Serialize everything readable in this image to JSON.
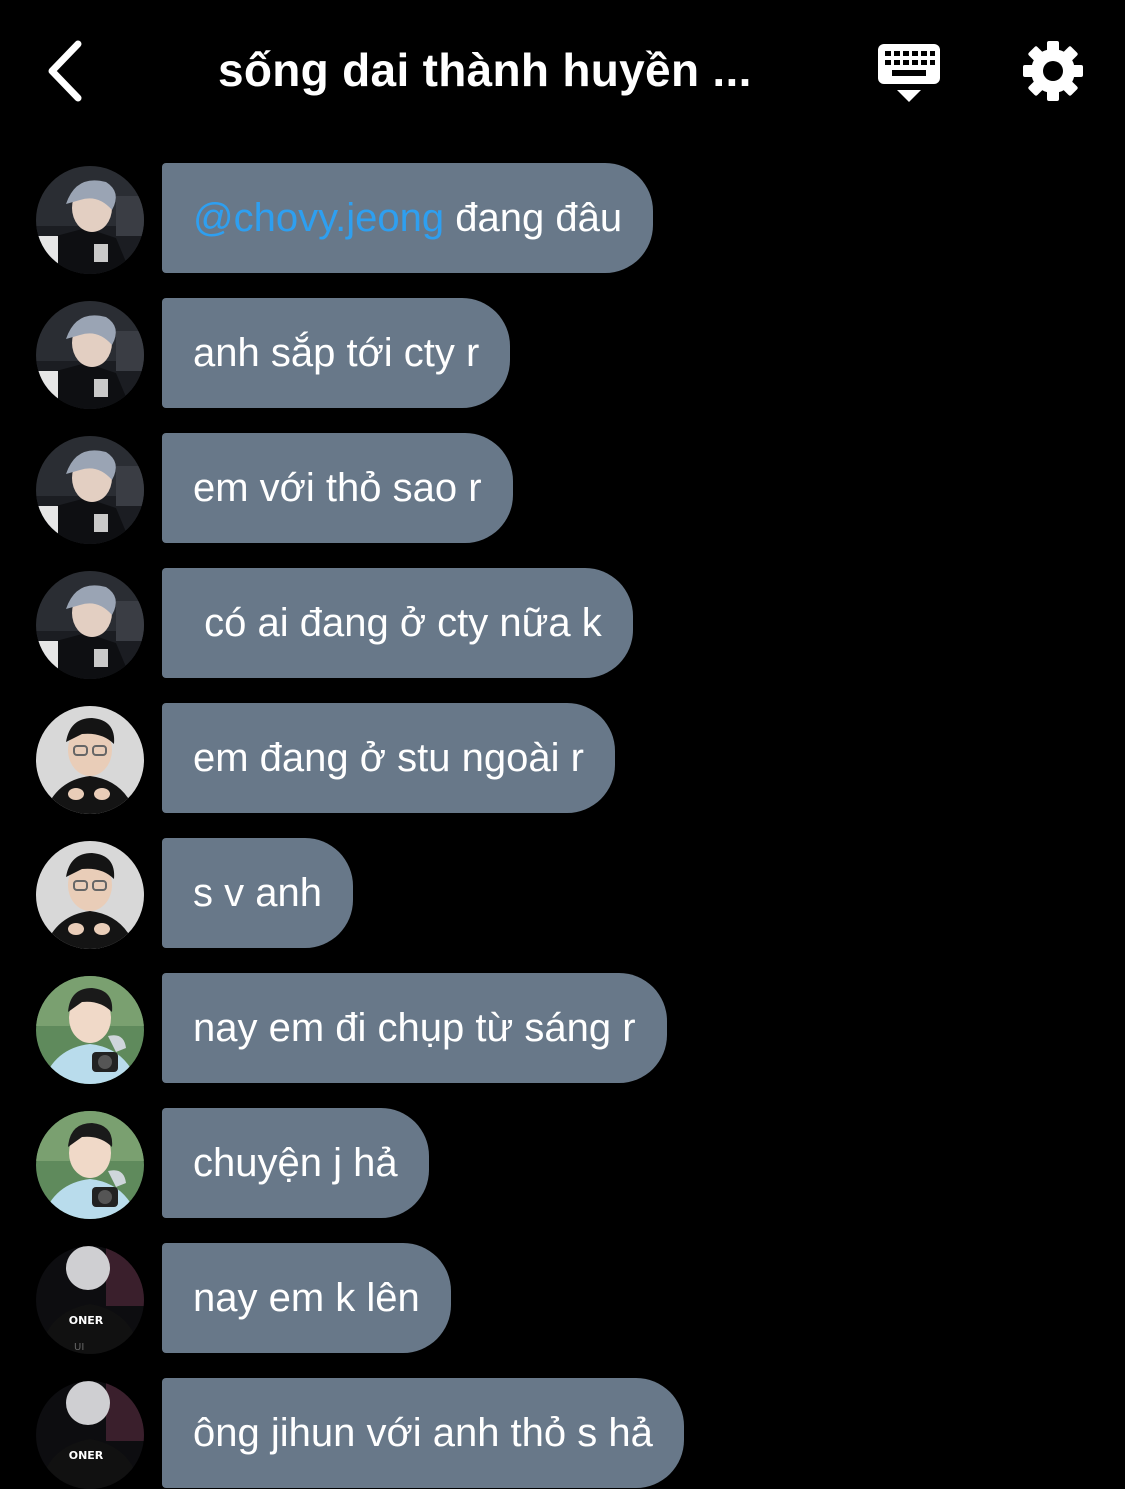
{
  "header": {
    "title": "sống dai thành huyền ...",
    "back_icon": "chevron-left-icon",
    "keyboard_icon": "keyboard-icon",
    "settings_icon": "gear-icon"
  },
  "colors": {
    "background": "#000000",
    "bubble": "#687889",
    "mention": "#2e9ff0",
    "text": "#ffffff"
  },
  "messages": [
    {
      "sender": "user-a",
      "mention": "@chovy.jeong",
      "text": " đang đâu"
    },
    {
      "sender": "user-a",
      "mention": "",
      "text": "anh sắp tới cty r"
    },
    {
      "sender": "user-a",
      "mention": "",
      "text": "em với thỏ sao r"
    },
    {
      "sender": "user-a",
      "mention": "",
      "text": " có ai đang ở cty nữa k"
    },
    {
      "sender": "user-b",
      "mention": "",
      "text": "em đang ở stu ngoài r"
    },
    {
      "sender": "user-b",
      "mention": "",
      "text": "s v anh"
    },
    {
      "sender": "user-c",
      "mention": "",
      "text": "nay em đi chụp từ sáng r"
    },
    {
      "sender": "user-c",
      "mention": "",
      "text": "chuyện j hả"
    },
    {
      "sender": "user-d",
      "mention": "",
      "text": "nay em k lên"
    },
    {
      "sender": "user-d",
      "mention": "",
      "text": "ông jihun với anh thỏ s hả"
    }
  ],
  "avatars": {
    "user-d": {
      "jersey_text": "ONER"
    }
  }
}
